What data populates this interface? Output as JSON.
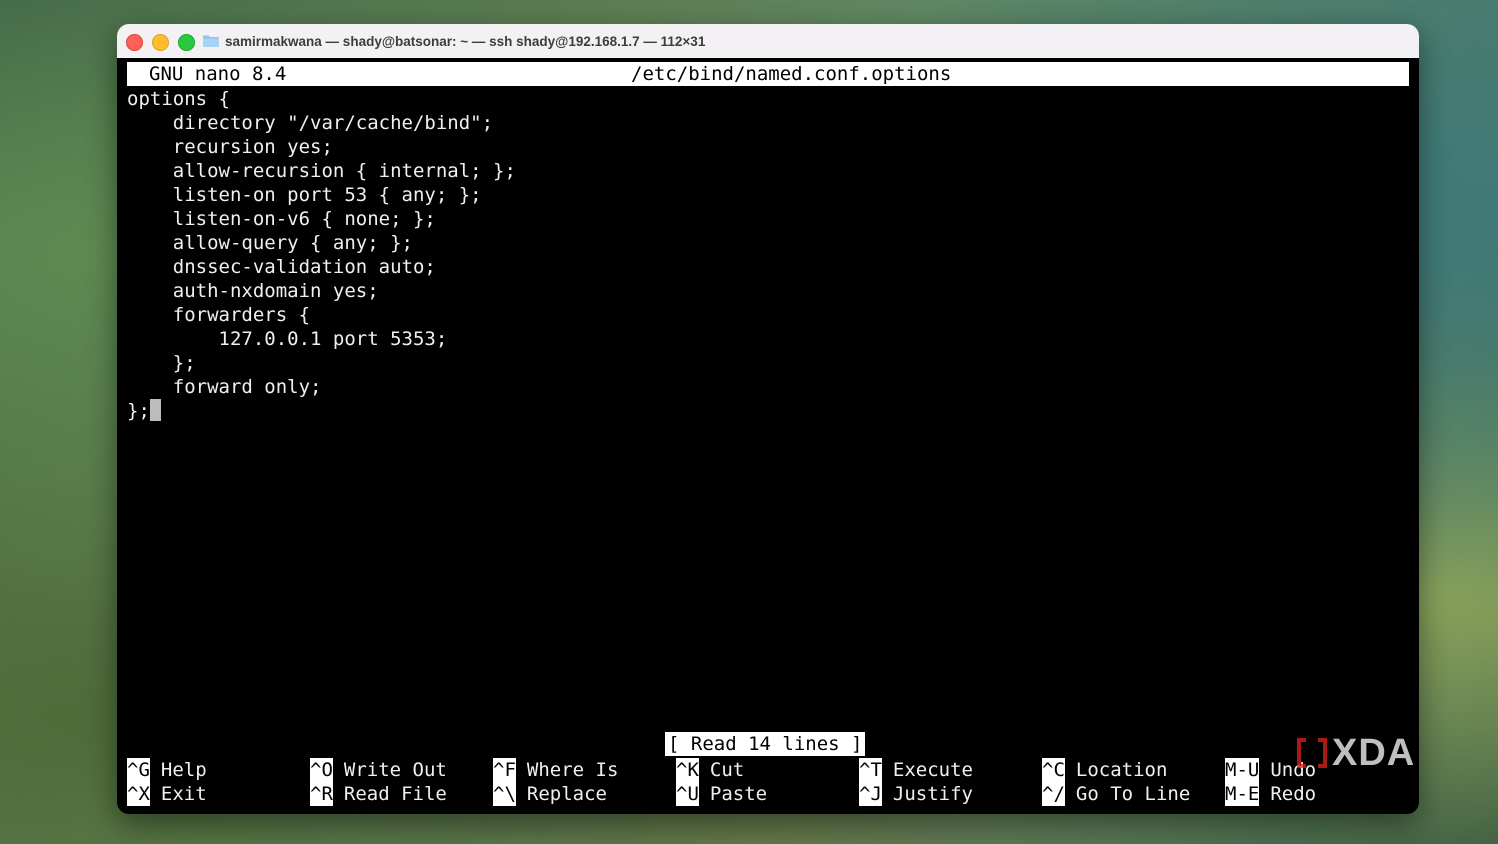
{
  "window": {
    "title": "samirmakwana — shady@batsonar: ~ — ssh shady@192.168.1.7 — 112×31",
    "traffic_lights": {
      "close": "#fe5f57",
      "minimize": "#febc2e",
      "zoom": "#28c840"
    },
    "folder_icon": "folder-icon"
  },
  "nano": {
    "version": "GNU nano 8.4",
    "filename": "/etc/bind/named.conf.options",
    "lines": [
      "options {",
      "    directory \"/var/cache/bind\";",
      "    recursion yes;",
      "    allow-recursion { internal; };",
      "    listen-on port 53 { any; };",
      "    listen-on-v6 { none; };",
      "    allow-query { any; };",
      "    dnssec-validation auto;",
      "    auth-nxdomain yes;",
      "    forwarders {",
      "        127.0.0.1 port 5353;",
      "    };",
      "    forward only;",
      "};"
    ],
    "status": "[ Read 14 lines ]",
    "shortcuts": [
      {
        "key": "^G",
        "label": "Help"
      },
      {
        "key": "^X",
        "label": "Exit"
      },
      {
        "key": "^O",
        "label": "Write Out"
      },
      {
        "key": "^R",
        "label": "Read File"
      },
      {
        "key": "^F",
        "label": "Where Is"
      },
      {
        "key": "^\\",
        "label": "Replace"
      },
      {
        "key": "^K",
        "label": "Cut"
      },
      {
        "key": "^U",
        "label": "Paste"
      },
      {
        "key": "^T",
        "label": "Execute"
      },
      {
        "key": "^J",
        "label": "Justify"
      },
      {
        "key": "^C",
        "label": "Location"
      },
      {
        "key": "^/",
        "label": "Go To Line"
      },
      {
        "key": "M-U",
        "label": "Undo"
      },
      {
        "key": "M-E",
        "label": "Redo"
      }
    ]
  },
  "watermark": {
    "text": "XDA",
    "accent": "#e2231a"
  }
}
